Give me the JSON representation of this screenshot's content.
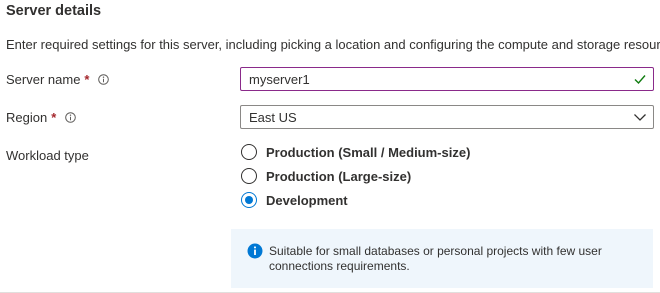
{
  "section": {
    "title": "Server details",
    "description": "Enter required settings for this server, including picking a location and configuring the compute and storage resources."
  },
  "server_name": {
    "label": "Server name",
    "required_mark": "*",
    "value": "myserver1",
    "info_icon": "info-icon",
    "status_icon": "checkmark-icon"
  },
  "region": {
    "label": "Region",
    "required_mark": "*",
    "value": "East US",
    "info_icon": "info-icon",
    "dropdown_icon": "chevron-down-icon"
  },
  "workload_type": {
    "label": "Workload type",
    "options": [
      {
        "label": "Production (Small / Medium-size)",
        "selected": false
      },
      {
        "label": "Production (Large-size)",
        "selected": false
      },
      {
        "label": "Development",
        "selected": true
      }
    ]
  },
  "info_banner": {
    "icon": "info-filled-icon",
    "text": "Suitable for small databases or personal projects with few user connections requirements."
  },
  "colors": {
    "accent": "#0078d4",
    "focus_border": "#8a2a8a",
    "required": "#a4262c",
    "success": "#107c10",
    "banner_bg": "#eff6fc"
  }
}
